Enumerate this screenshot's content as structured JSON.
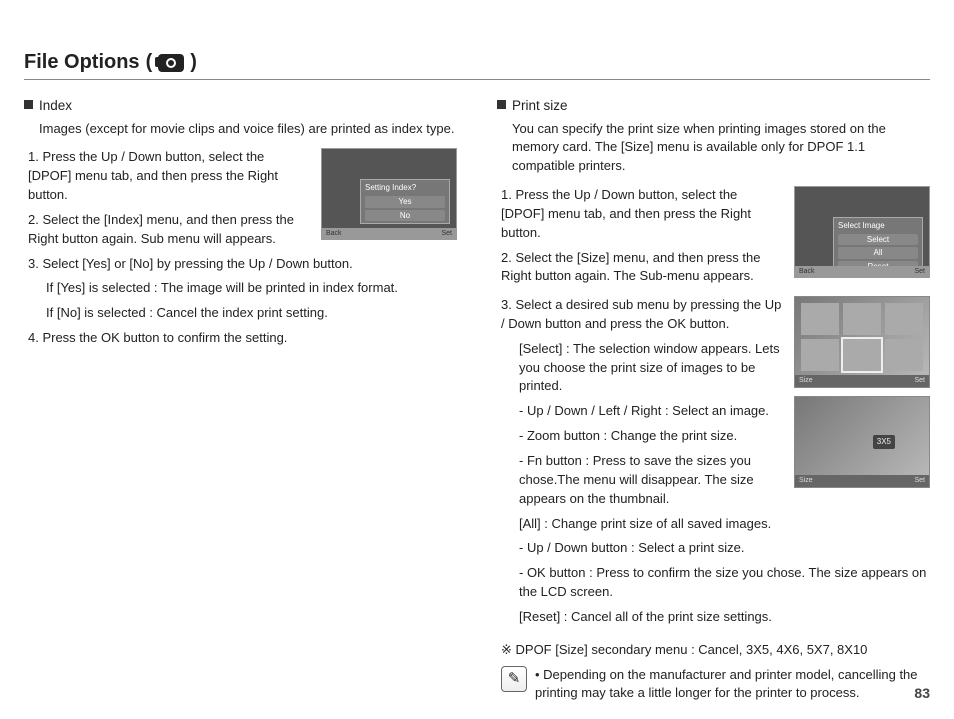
{
  "title": "File Options",
  "page_number": "83",
  "left": {
    "section_title": "Index",
    "section_desc": "Images (except for movie clips and voice files) are printed as index type.",
    "steps": [
      "1. Press the Up / Down button, select the [DPOF] menu tab, and then press the Right button.",
      "2. Select the [Index] menu, and then press the Right button again. Sub menu will appears."
    ],
    "steps_after": [
      "3. Select [Yes] or [No] by pressing the Up / Down button.",
      "4. Press the OK button to confirm the setting."
    ],
    "step3_sub": [
      "If [Yes] is selected : The image will be printed in index format.",
      "If [No] is selected   : Cancel the index print setting."
    ],
    "shot": {
      "menu_title": "Setting Index?",
      "opt_yes": "Yes",
      "opt_no": "No",
      "bar_back": "Back",
      "bar_set": "Set"
    }
  },
  "right": {
    "section_title": "Print size",
    "section_desc": "You can specify the print size when printing images stored on the memory card. The [Size] menu is available only for DPOF 1.1 compatible printers.",
    "steps_top": [
      "1. Press the Up / Down button, select the [DPOF] menu tab, and then press the Right button.",
      "2. Select the [Size] menu, and then press the Right button again. The Sub-menu appears."
    ],
    "step3": "3. Select a desired sub menu by pressing the Up / Down button and press the OK button.",
    "step3_sub": [
      "[Select] : The selection window appears. Lets you choose the print size of images to be printed.",
      "- Up / Down / Left / Right : Select an image.",
      "- Zoom button : Change the print size.",
      "- Fn button : Press to save the sizes you chose.The menu will disappear. The size appears on the thumbnail.",
      "[All] : Change print size of all saved images.",
      "- Up / Down button : Select a print size.",
      "- OK button : Press to confirm the size you chose. The size appears on the LCD screen.",
      "[Reset] : Cancel all of the print size settings."
    ],
    "shot1": {
      "menu_title": "Select Image",
      "opt_select": "Select",
      "opt_all": "All",
      "opt_reset": "Reset",
      "bar_back": "Back",
      "bar_set": "Set"
    },
    "shot2": {
      "bar_size": "Size",
      "bar_set": "Set"
    },
    "shot3": {
      "badge": "3X5",
      "bar_size": "Size",
      "bar_set": "Set"
    },
    "dpof_line": "※ DPOF [Size] secondary menu : Cancel, 3X5, 4X6, 5X7, 8X10",
    "note": "Depending on the manufacturer and printer model, cancelling the printing may take a little longer for the printer to process."
  }
}
